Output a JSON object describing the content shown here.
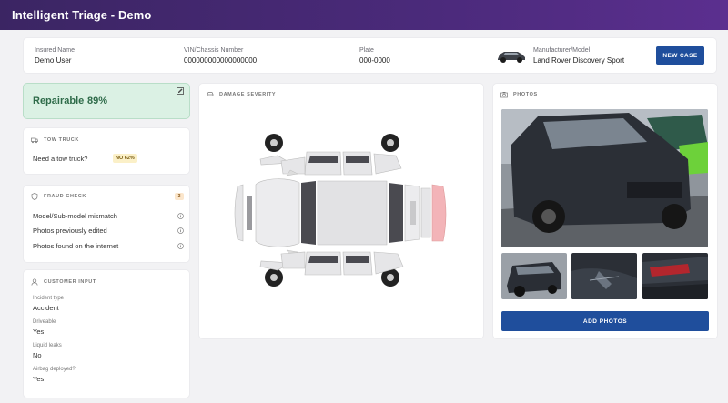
{
  "app": {
    "title": "Intelligent Triage - Demo"
  },
  "header": {
    "insured_name_label": "Insured Name",
    "insured_name": "Demo User",
    "vin_label": "VIN/Chassis Number",
    "vin": "000000000000000000",
    "plate_label": "Plate",
    "plate": "000-0000",
    "model_label": "Manufacturer/Model",
    "model": "Land Rover Discovery Sport",
    "new_case_label": "NEW CASE"
  },
  "repairable": {
    "label": "Repairable",
    "percent": "89%"
  },
  "tow": {
    "title": "TOW TRUCK",
    "question": "Need a tow truck?",
    "badge": "NO 62%"
  },
  "fraud": {
    "title": "FRAUD CHECK",
    "count": "3",
    "items": [
      "Model/Sub-model mismatch",
      "Photos previously edited",
      "Photos found on the internet"
    ]
  },
  "customer": {
    "title": "CUSTOMER INPUT",
    "fields": [
      {
        "label": "Incident type",
        "value": "Accident"
      },
      {
        "label": "Driveable",
        "value": "Yes"
      },
      {
        "label": "Liquid leaks",
        "value": "No"
      },
      {
        "label": "Airbag deployed?",
        "value": "Yes"
      }
    ]
  },
  "damage": {
    "title": "DAMAGE SEVERITY",
    "damage_color": "#f3b4b8"
  },
  "photos": {
    "title": "PHOTOS",
    "add_label": "ADD PHOTOS"
  },
  "colors": {
    "accent": "#1f4e9c",
    "header_start": "#3b2563",
    "repairable_bg": "#dbf1e4"
  }
}
